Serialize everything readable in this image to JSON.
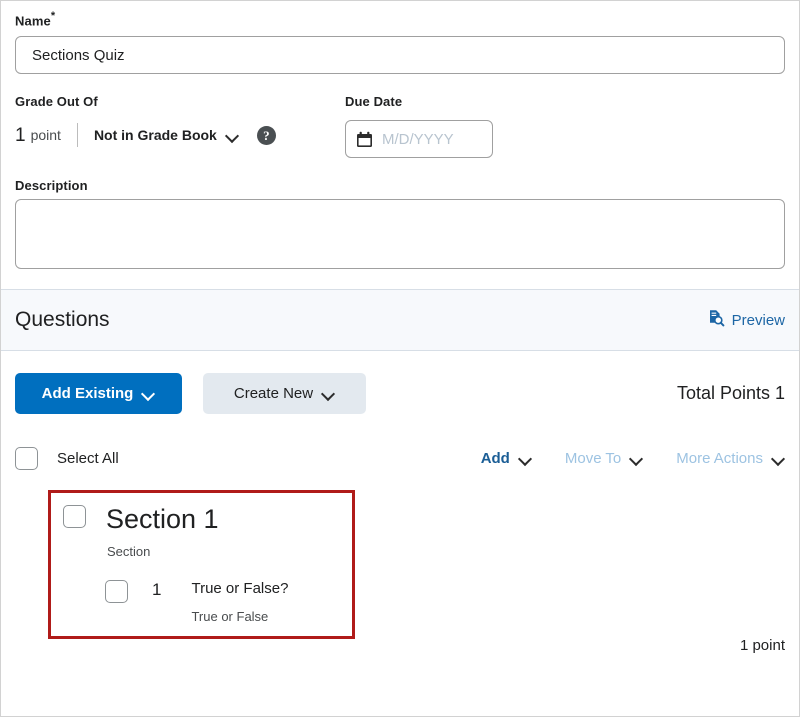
{
  "form": {
    "name": {
      "label": "Name",
      "required_marker": "*",
      "value": "Sections Quiz"
    },
    "grade_out_of": {
      "label": "Grade Out Of",
      "points_number": "1",
      "points_unit": "point",
      "gradebook_select_value": "Not in Grade Book",
      "help_icon_glyph": "?"
    },
    "due_date": {
      "label": "Due Date",
      "placeholder": "M/D/YYYY",
      "value": ""
    },
    "description": {
      "label": "Description",
      "value": ""
    }
  },
  "questions_header": {
    "title": "Questions",
    "preview_label": "Preview"
  },
  "toolbar": {
    "add_existing_label": "Add Existing",
    "create_new_label": "Create New",
    "total_points_label": "Total Points 1"
  },
  "list_controls": {
    "select_all_label": "Select All",
    "add_label": "Add",
    "move_to_label": "Move To",
    "more_actions_label": "More Actions"
  },
  "section": {
    "title": "Section 1",
    "subtitle": "Section",
    "question": {
      "number": "1",
      "title": "True or False?",
      "type": "True or False",
      "points": "1 point"
    }
  },
  "colors": {
    "primary_blue": "#006fbf",
    "link_blue": "#1b5e96",
    "disabled_blue": "#9dc3e2",
    "highlight_red": "#b01b19",
    "band_background": "#f7f9fc",
    "secondary_button": "#e3e9ef"
  }
}
